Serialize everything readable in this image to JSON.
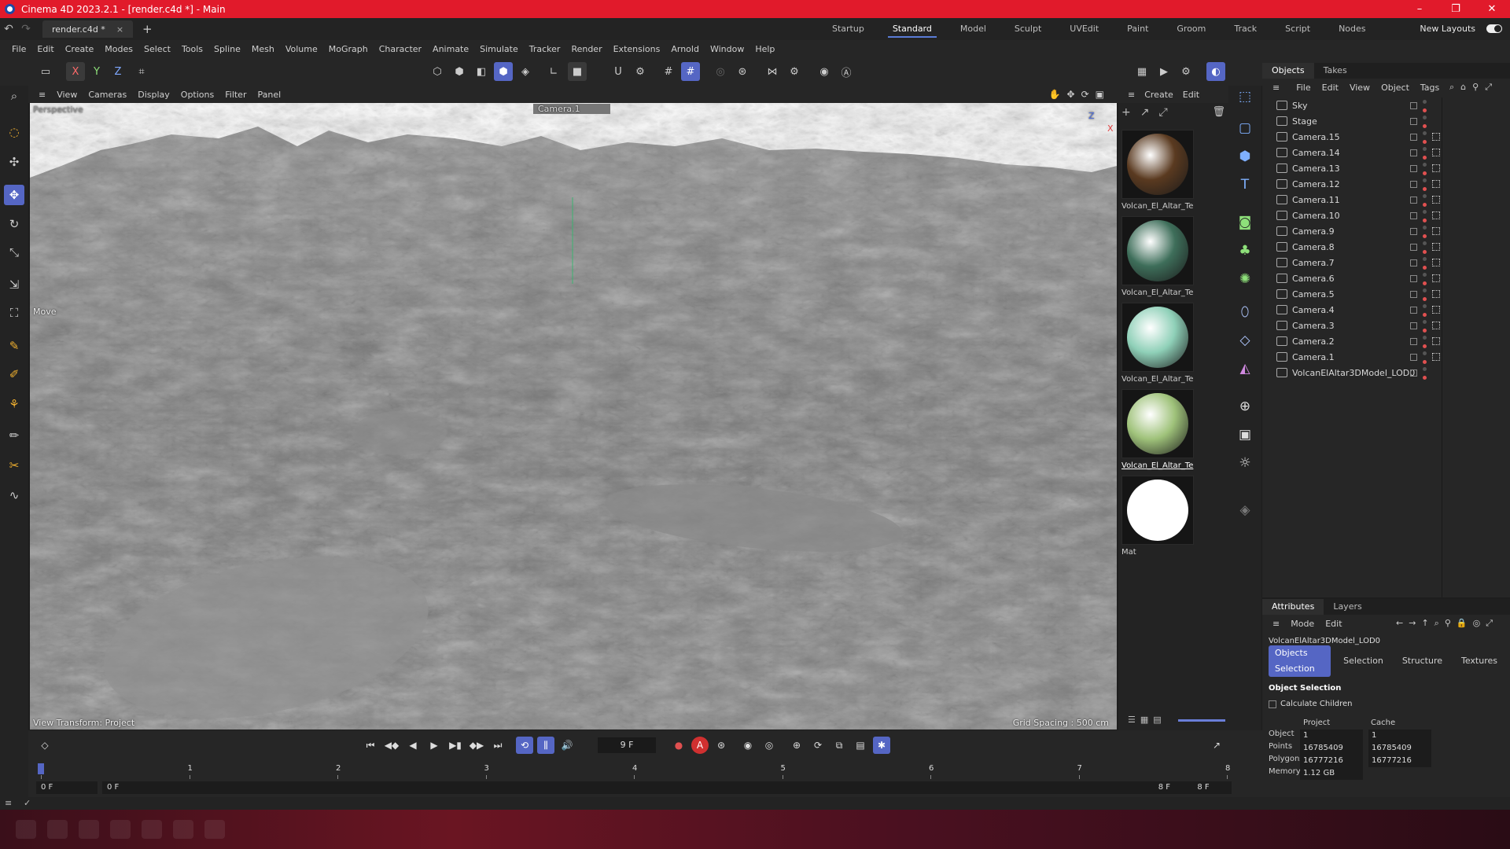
{
  "window": {
    "title": "Cinema 4D 2023.2.1 - [render.c4d *] - Main",
    "min": "–",
    "max": "❐",
    "close": "✕"
  },
  "tabs": {
    "doc": "render.c4d *",
    "close": "×",
    "add": "+"
  },
  "layouts": [
    "Startup",
    "Standard",
    "Model",
    "Sculpt",
    "UVEdit",
    "Paint",
    "Groom",
    "Track",
    "Script",
    "Nodes"
  ],
  "layouts_active": "Standard",
  "new_layouts": "New Layouts",
  "menu": [
    "File",
    "Edit",
    "Create",
    "Modes",
    "Select",
    "Tools",
    "Spline",
    "Mesh",
    "Volume",
    "MoGraph",
    "Character",
    "Animate",
    "Simulate",
    "Tracker",
    "Render",
    "Extensions",
    "Arnold",
    "Window",
    "Help"
  ],
  "toolbar": {
    "x_axis": "X",
    "y_axis": "Y",
    "z_axis": "Z"
  },
  "viewport": {
    "menu": [
      "View",
      "Cameras",
      "Display",
      "Options",
      "Filter",
      "Panel"
    ],
    "mode": "Perspective",
    "camera": "Camera.1",
    "tool": "Move",
    "transform": "View Transform: Project",
    "grid": "Grid Spacing : 500 cm",
    "axis_z": "Z",
    "axis_x": "X"
  },
  "materials": {
    "menu": [
      "Create",
      "Edit"
    ],
    "items": [
      {
        "name": "Volcan_El_Altar_Te"
      },
      {
        "name": "Volcan_El_Altar_Te"
      },
      {
        "name": "Volcan_El_Altar_Te"
      },
      {
        "name": "Volcan_El_Altar_Te"
      },
      {
        "name": "Mat"
      }
    ],
    "colors": [
      "#5a3a20",
      "#3e6e5a",
      "#8fd0b8",
      "#9fc27a",
      "#ffffff"
    ]
  },
  "objects": {
    "tabs": [
      "Objects",
      "Takes"
    ],
    "menu": [
      "File",
      "Edit",
      "View",
      "Object",
      "Tags"
    ],
    "rows": [
      "Sky",
      "Stage",
      "Camera.15",
      "Camera.14",
      "Camera.13",
      "Camera.12",
      "Camera.11",
      "Camera.10",
      "Camera.9",
      "Camera.8",
      "Camera.7",
      "Camera.6",
      "Camera.5",
      "Camera.4",
      "Camera.3",
      "Camera.2",
      "Camera.1",
      "VolcanElAltar3DModel_LOD0"
    ]
  },
  "attributes": {
    "tabs": [
      "Attributes",
      "Layers"
    ],
    "menu": [
      "Mode",
      "Edit"
    ],
    "object_name": "VolcanElAltar3DModel_LOD0",
    "subtabs": [
      "Objects Selection",
      "Selection",
      "Structure",
      "Textures"
    ],
    "section": "Object Selection",
    "calc_children": "Calculate Children",
    "col_project": "Project",
    "col_cache": "Cache",
    "rows": [
      {
        "label": "Object",
        "project": "1",
        "cache": "1"
      },
      {
        "label": "Points",
        "project": "16785409",
        "cache": "16785409"
      },
      {
        "label": "Polygons",
        "project": "16777216",
        "cache": "16777216"
      },
      {
        "label": "Memory",
        "project": "1.12 GB",
        "cache": ""
      }
    ]
  },
  "timeline": {
    "current_frame": "9 F",
    "ticks": [
      "0",
      "1",
      "2",
      "3",
      "4",
      "5",
      "6",
      "7",
      "8"
    ],
    "start": "0 F",
    "range_start": "0 F",
    "range_end": "8 F",
    "end": "8 F"
  }
}
